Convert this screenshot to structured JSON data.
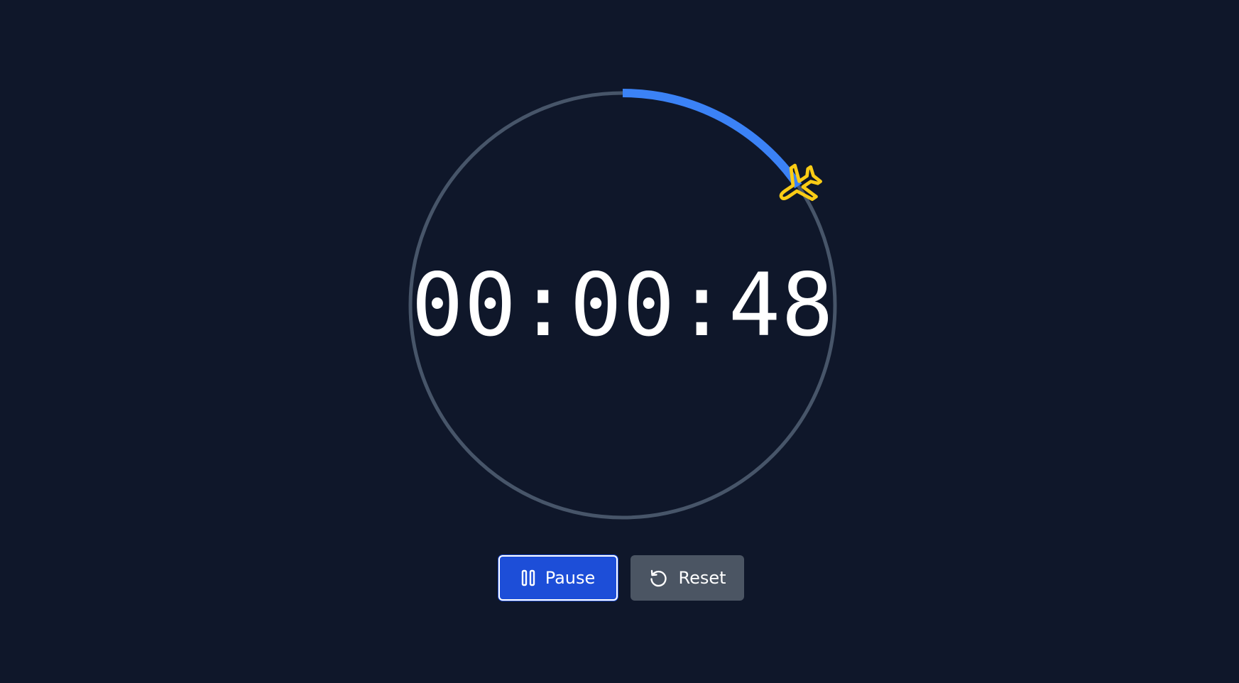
{
  "timer": {
    "display": "00:00:48",
    "progress_fraction": 0.155
  },
  "controls": {
    "pause_label": "Pause",
    "reset_label": "Reset"
  },
  "icons": {
    "progress_marker": "airplane-icon",
    "pause": "pause-icon",
    "reset": "reset-icon"
  },
  "colors": {
    "background": "#0f172a",
    "track": "#475569",
    "progress": "#3b82f6",
    "marker": "#facc15",
    "pause_button": "#1d4ed8",
    "reset_button": "#4b5563",
    "text": "#ffffff"
  }
}
